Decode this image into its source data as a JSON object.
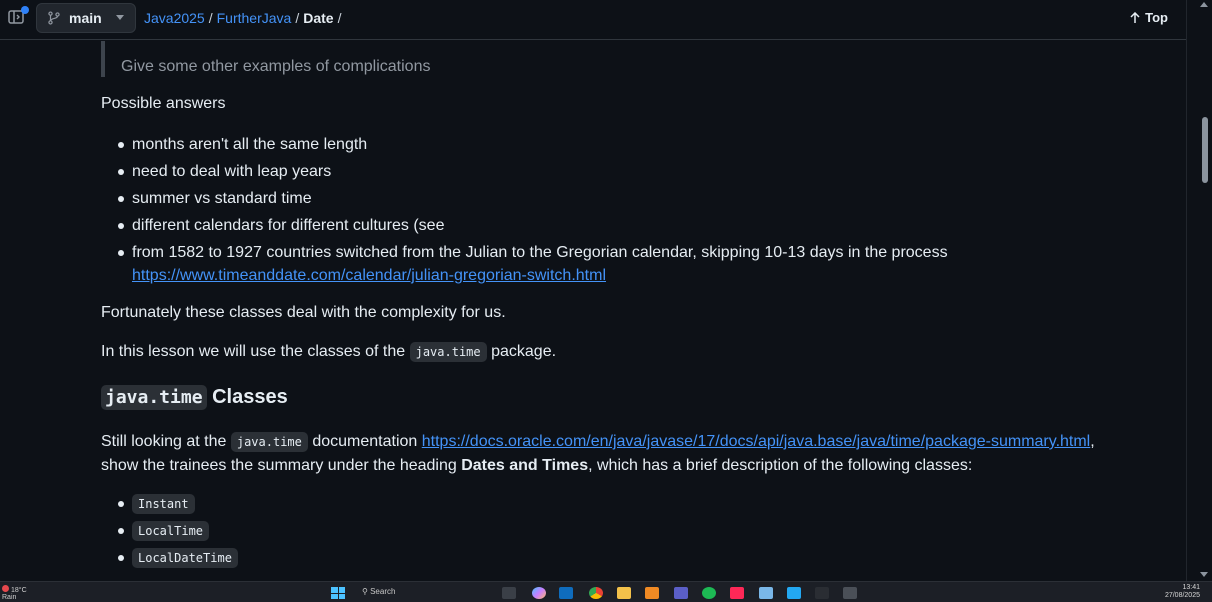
{
  "header": {
    "branch": "main",
    "breadcrumb": [
      "Java2025",
      "FurtherJava",
      "Date"
    ],
    "breadcrumb_sep": "/",
    "top_label": "Top"
  },
  "content": {
    "quote": "Give some other examples of complications",
    "possible_answers": "Possible answers",
    "answers": [
      "months aren't all the same length",
      "need to deal with leap years",
      "summer vs standard time",
      "different calendars for different cultures (see"
    ],
    "switch_text": "from 1582 to 1927 countries switched from the Julian to the Gregorian calendar, skipping 10-13 days in the process",
    "switch_link": "https://www.timeanddate.com/calendar/julian-gregorian-switch.html",
    "fortunately": "Fortunately these classes deal with the complexity for us.",
    "lesson_pre": "In this lesson we will use the classes of the",
    "lesson_code": "java.time",
    "lesson_post": "package.",
    "heading_code": "java.time",
    "heading_text": "Classes",
    "still_pre": "Still looking at the",
    "still_code": "java.time",
    "still_mid": "documentation",
    "still_link": "https://docs.oracle.com/en/java/javase/17/docs/api/java.base/java/time/package-summary.html",
    "still_comma": ",",
    "summary_pre": "show the trainees the summary under the heading",
    "summary_bold": "Dates and Times",
    "summary_post": ", which has a brief description of the following classes:",
    "classes": [
      "Instant",
      "LocalTime",
      "LocalDateTime"
    ]
  },
  "taskbar": {
    "temperature": "18°C",
    "weather": "Rain",
    "search_placeholder": "Search",
    "time": "13:41",
    "date": "27/08/2025",
    "app_icons": [
      "file-explorer-icon",
      "copilot-icon",
      "outlook-icon",
      "chrome-icon",
      "folder-icon",
      "app-icon",
      "teams-icon",
      "spotify-icon",
      "intellij-icon",
      "notepad-icon",
      "vscode-icon",
      "typora-icon",
      "terminal-icon"
    ]
  },
  "colors": {
    "background": "#0d1117",
    "link": "#4493f8",
    "text": "#e6edf3",
    "muted": "#9198a1"
  }
}
